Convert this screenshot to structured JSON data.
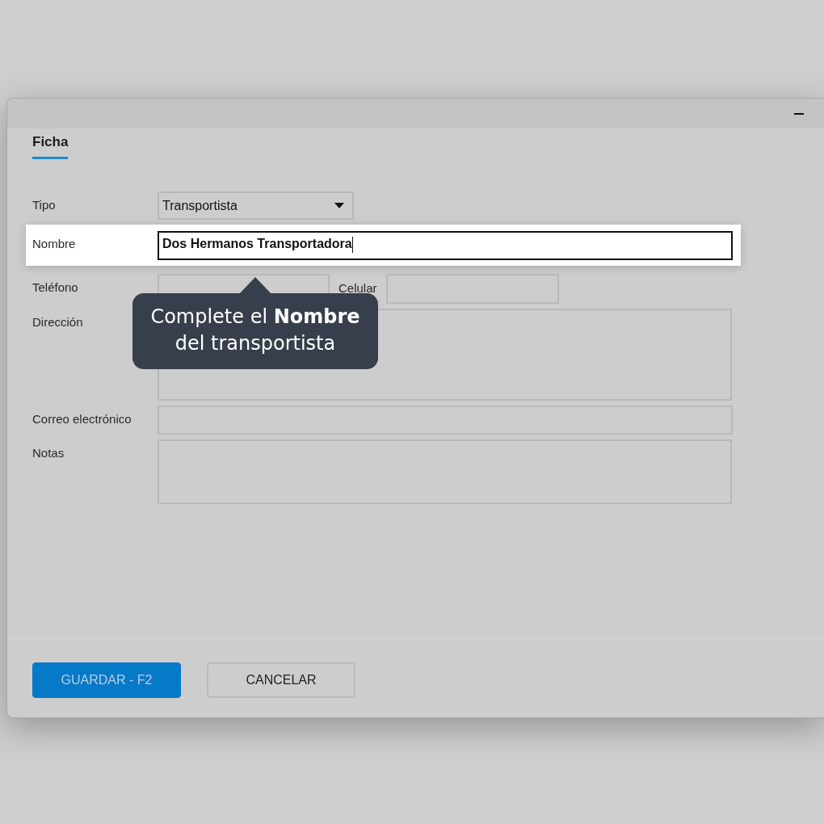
{
  "tabs": [
    {
      "label": "Ficha",
      "selected": true
    }
  ],
  "fields": [
    {
      "kind": "select",
      "label": "Tipo",
      "value": "Transportista",
      "highlighted": false
    },
    {
      "kind": "text",
      "label": "Nombre",
      "value": "Dos Hermanos Transportadora",
      "highlighted": true
    },
    {
      "kind": "pair",
      "label": "Teléfono",
      "second_label": "Celular",
      "highlighted": false
    },
    {
      "kind": "textarea",
      "label": "Dirección",
      "highlighted": false
    },
    {
      "kind": "text",
      "label": "Correo electrónico",
      "highlighted": false
    },
    {
      "kind": "textarea",
      "label": "Notas",
      "highlighted": false
    }
  ],
  "tooltip": {
    "text": "Complete el **Nombre** del transportista"
  },
  "buttons": [
    {
      "label": "GUARDAR - F2",
      "kind": "primary"
    },
    {
      "label": "CANCELAR",
      "kind": "secondary"
    }
  ]
}
